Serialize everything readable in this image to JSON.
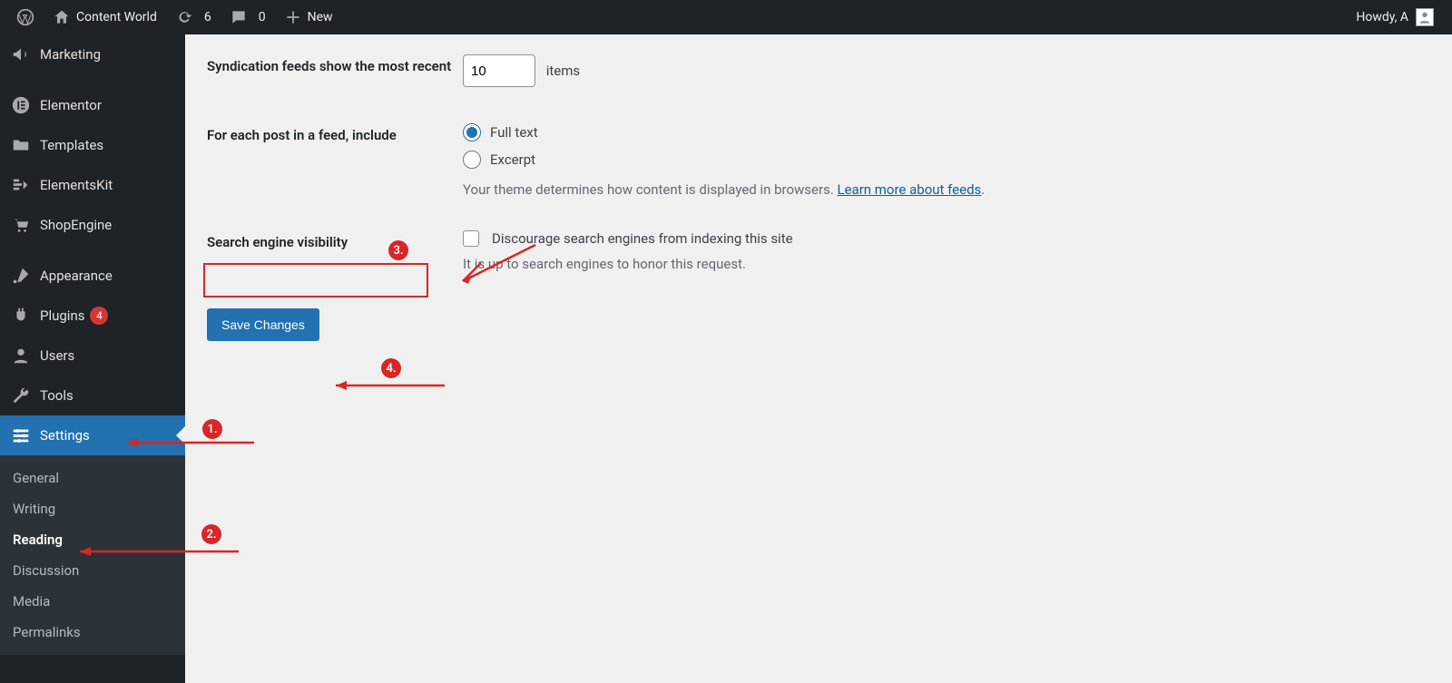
{
  "adminBar": {
    "siteName": "Content World",
    "updatesCount": "6",
    "commentsCount": "0",
    "newLabel": "New",
    "howdy": "Howdy, A"
  },
  "sidebar": {
    "items": [
      {
        "label": "Marketing"
      },
      {
        "label": "Elementor"
      },
      {
        "label": "Templates"
      },
      {
        "label": "ElementsKit"
      },
      {
        "label": "ShopEngine"
      },
      {
        "label": "Appearance"
      },
      {
        "label": "Plugins",
        "badge": "4"
      },
      {
        "label": "Users"
      },
      {
        "label": "Tools"
      },
      {
        "label": "Settings",
        "active": true
      }
    ],
    "submenu": [
      {
        "label": "General"
      },
      {
        "label": "Writing"
      },
      {
        "label": "Reading",
        "current": true
      },
      {
        "label": "Discussion"
      },
      {
        "label": "Media"
      },
      {
        "label": "Permalinks"
      }
    ]
  },
  "form": {
    "syndication": {
      "label": "Syndication feeds show the most recent",
      "value": "10",
      "suffix": "items"
    },
    "feedInclude": {
      "label": "For each post in a feed, include",
      "opt1": "Full text",
      "opt2": "Excerpt",
      "descPrefix": "Your theme determines how content is displayed in browsers. ",
      "descLink": "Learn more about feeds",
      "descSuffix": "."
    },
    "sev": {
      "label": "Search engine visibility",
      "checkbox": "Discourage search engines from indexing this site",
      "note": "It is up to search engines to honor this request."
    },
    "saveLabel": "Save Changes"
  },
  "annotations": {
    "b1": "1.",
    "b2": "2.",
    "b3": "3.",
    "b4": "4."
  }
}
